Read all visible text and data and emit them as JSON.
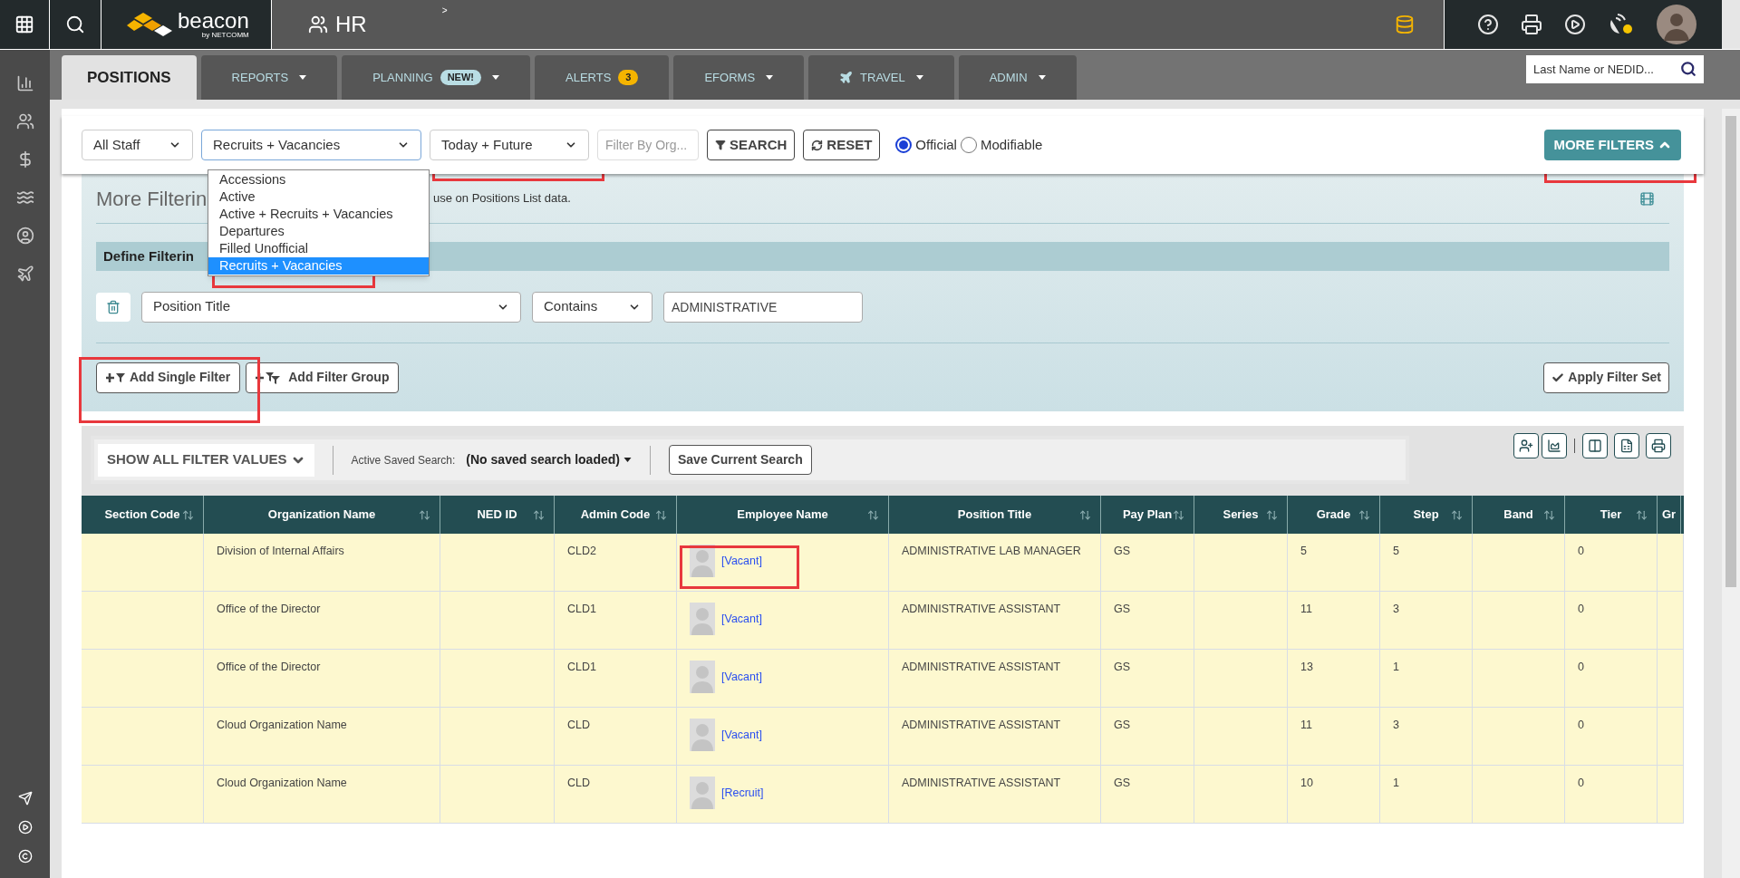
{
  "top_bar": {
    "breadcrumb_mark": ">",
    "logo_name": "beacon",
    "logo_byline": "by NETCOMM",
    "module": "HR"
  },
  "tabs": [
    {
      "label": "POSITIONS",
      "selected": true,
      "has_menu": false,
      "has_icon": false
    },
    {
      "label": "REPORTS",
      "selected": false,
      "has_menu": true,
      "has_icon": false
    },
    {
      "label": "PLANNING",
      "selected": false,
      "has_menu": true,
      "has_icon": false,
      "badge": {
        "text": "NEW!",
        "color": "#b9dde4"
      }
    },
    {
      "label": "ALERTS",
      "selected": false,
      "has_menu": false,
      "has_icon": false,
      "badge": {
        "text": "3",
        "color": "#f5b400"
      }
    },
    {
      "label": "EFORMS",
      "selected": false,
      "has_menu": true,
      "has_icon": false
    },
    {
      "label": "TRAVEL",
      "selected": false,
      "has_menu": true,
      "has_icon": true
    },
    {
      "label": "ADMIN",
      "selected": false,
      "has_menu": true,
      "has_icon": false
    }
  ],
  "quick_search": {
    "placeholder": "Last Name or NEDID..."
  },
  "filter_bar": {
    "staff_select": "All Staff",
    "status_select": "Recruits + Vacancies",
    "date_select": "Today + Future",
    "org_filter": {
      "placeholder": "Filter By Org..."
    },
    "search_button": "SEARCH",
    "reset_button": "RESET",
    "record_type": [
      {
        "label": "Official",
        "selected": true
      },
      {
        "label": "Modifiable",
        "selected": false
      }
    ],
    "more_filters_button": "MORE FILTERS"
  },
  "status_dropdown": {
    "options": [
      {
        "label": "Accessions",
        "selected": false
      },
      {
        "label": "Active",
        "selected": false
      },
      {
        "label": "Active + Recruits + Vacancies",
        "selected": false
      },
      {
        "label": "Departures",
        "selected": false
      },
      {
        "label": "Filled Unofficial",
        "selected": false
      },
      {
        "label": "Recruits + Vacancies",
        "selected": true
      }
    ]
  },
  "more_filtering": {
    "title": "More Filterin",
    "note": "use on Positions List data.",
    "section_title": "Define Filterin",
    "filter": {
      "field": "Position Title",
      "operator": "Contains",
      "value": "ADMINISTRATIVE"
    },
    "add_single_filter": "Add Single Filter",
    "add_filter_group": "Add Filter Group",
    "apply_button": "Apply Filter Set"
  },
  "toolbar": {
    "show_all_button": "SHOW ALL FILTER VALUES",
    "saved_search_label": "Active Saved Search:",
    "saved_search_value": "(No saved search loaded)",
    "save_button": "Save Current Search"
  },
  "table": {
    "columns": [
      "Section Code",
      "Organization Name",
      "NED ID",
      "Admin Code",
      "Employee Name",
      "Position Title",
      "Pay Plan",
      "Series",
      "Grade",
      "Step",
      "Band",
      "Tier",
      "Gr"
    ],
    "rows": [
      {
        "cells": [
          "",
          "Division of Internal Affairs",
          "",
          "CLD2",
          "[Vacant]",
          "ADMINISTRATIVE LAB MANAGER",
          "GS",
          "",
          "5",
          "5",
          "",
          "0",
          ""
        ]
      },
      {
        "cells": [
          "",
          "Office of the Director",
          "",
          "CLD1",
          "[Vacant]",
          "ADMINISTRATIVE ASSISTANT",
          "GS",
          "",
          "11",
          "3",
          "",
          "0",
          ""
        ]
      },
      {
        "cells": [
          "",
          "Office of the Director",
          "",
          "CLD1",
          "[Vacant]",
          "ADMINISTRATIVE ASSISTANT",
          "GS",
          "",
          "13",
          "1",
          "",
          "0",
          ""
        ]
      },
      {
        "cells": [
          "",
          "Cloud Organization Name",
          "",
          "CLD",
          "[Vacant]",
          "ADMINISTRATIVE ASSISTANT",
          "GS",
          "",
          "11",
          "3",
          "",
          "0",
          ""
        ]
      },
      {
        "cells": [
          "",
          "Cloud Organization Name",
          "",
          "CLD",
          "[Recruit]",
          "ADMINISTRATIVE ASSISTANT",
          "GS",
          "",
          "10",
          "1",
          "",
          "0",
          ""
        ]
      }
    ]
  }
}
